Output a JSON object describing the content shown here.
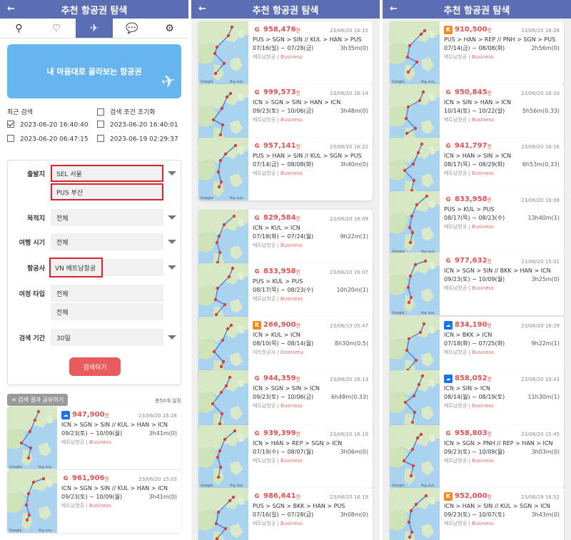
{
  "header": {
    "title": "추천 항공권 탐색",
    "back": "←"
  },
  "tabs": [
    {
      "icon": "search-icon",
      "glyph": "⚲"
    },
    {
      "icon": "heart-icon",
      "glyph": "♡"
    },
    {
      "icon": "ticket-icon",
      "glyph": "✈"
    },
    {
      "icon": "chat-icon",
      "glyph": "💬"
    },
    {
      "icon": "gear-icon",
      "glyph": "⚙"
    }
  ],
  "banner": {
    "text": "내 마음대로 골라보는 항공권"
  },
  "recent": {
    "label": "최근 검색",
    "reset": "검색 조건 초기화",
    "items": [
      "2023-06-20 16:40:40",
      "2023-06-20 16:40:01",
      "2023-06-20 06:47:15",
      "2023-06-19 02:29:37"
    ]
  },
  "form": {
    "departure_label": "출발지",
    "departure_1": "SEL 서울",
    "departure_2": "PUS 부산",
    "destination_label": "목적지",
    "destination": "전체",
    "period_label": "여행 시기",
    "period": "전체",
    "airline_label": "항공사",
    "airline": "VN 베트남항공",
    "tripType_label": "여정 타입",
    "tripType_1": "전체",
    "tripType_2": "전체",
    "range_label": "검색 기간",
    "range": "30일",
    "search_button": "검색하기"
  },
  "share": {
    "button": "검색 결과 공유하기",
    "total": "총50개 일정"
  },
  "won": "원",
  "p1cards": [
    {
      "logo": "s",
      "price": "947,900",
      "time": "23/06/20 16:28",
      "route": "ICN > SGN > SIN // KUL > HAN > ICN",
      "dates": "09/23(토) ~ 10/09(월)",
      "dur": "3h41m(0)",
      "airline": "베트남항공",
      "cls": "Business"
    },
    {
      "logo": "g",
      "price": "961,906",
      "time": "23/06/20 15:03",
      "route": "ICN > SGN > SIN // KUL > HAN > ICN",
      "dates": "09/23(토) ~ 10/09(월)",
      "dur": "3h41m(0)",
      "airline": "베트남항공",
      "cls": "Business"
    }
  ],
  "p2cards": [
    {
      "logo": "g",
      "price": "958,476",
      "time": "23/06/20 16:15",
      "route": "PUS > SGN > SIN // KUL > HAN > PUS",
      "dates": "07/16(일) ~ 07/28(금)",
      "dur": "3h35m(0)",
      "airline": "베트남항공",
      "cls": "Business"
    },
    {
      "logo": "g",
      "price": "999,573",
      "time": "23/06/20 16:14",
      "route": "ICN > SGN > SIN > HAN > ICN",
      "dates": "09/23(토) ~ 10/06(금)",
      "dur": "3h48m(0)",
      "airline": "베트남항공",
      "cls": "Business"
    },
    {
      "logo": "g",
      "price": "957,141",
      "time": "23/06/20 16:22",
      "route": "PUS > HAN > SIN // KUL > SGN > PUS",
      "dates": "07/14(금) ~ 08/08(화)",
      "dur": "3h40m(0)",
      "airline": "베트남항공",
      "cls": "Business"
    },
    {
      "logo": "g",
      "price": "829,584",
      "time": "23/06/20 16:09",
      "route": "ICN > KUL > ICN",
      "dates": "07/18(화) ~ 07/24(월)",
      "dur": "9h22m(1)",
      "airline": "베트남항공",
      "cls": "Business"
    },
    {
      "logo": "g",
      "price": "833,958",
      "time": "23/06/20 16:07",
      "route": "PUS > KUL > PUS",
      "dates": "08/17(목) ~ 08/23(수)",
      "dur": "10h20m(1)",
      "airline": "베트남항공",
      "cls": "Business"
    },
    {
      "logo": "k",
      "price": "266,900",
      "time": "23/06/15 05:47",
      "route": "ICN > KUL > ICN",
      "dates": "08/10(목) ~ 08/14(월)",
      "dur": "8h30m(0.5)",
      "airline": "여러항공사",
      "cls": "Economy"
    },
    {
      "logo": "g",
      "price": "944,359",
      "time": "23/06/20 16:13",
      "route": "ICN > SGN > SIN > ICN",
      "dates": "09/23(토) ~ 10/06(금)",
      "dur": "6h48m(0.33)",
      "airline": "베트남항공",
      "cls": "Business"
    },
    {
      "logo": "g",
      "price": "939,399",
      "time": "23/06/20 16:19",
      "route": "ICN > HAN > REP > SGN > ICN",
      "dates": "07/19(수) ~ 08/07(월)",
      "dur": "3h06m(0)",
      "airline": "베트남항공",
      "cls": "Business"
    },
    {
      "logo": "g",
      "price": "986,641",
      "time": "23/06/20 16:19",
      "route": "PUS > SGN > BKK > HAN > PUS",
      "dates": "07/16(일) ~ 07/28(금)",
      "dur": "3h08m(0)",
      "airline": "베트남항공",
      "cls": "Business"
    }
  ],
  "p3cards": [
    {
      "logo": "k",
      "price": "910,500",
      "time": "23/06/20 16:28",
      "route": "PUS > HAN > REP // PNH > SGN > PUS",
      "dates": "07/14(금) ~ 08/08(화)",
      "dur": "2h56m(0)",
      "airline": "베트남항공",
      "cls": "Business"
    },
    {
      "logo": "g",
      "price": "950,845",
      "time": "23/06/20 16:10",
      "route": "ICN > SIN > HAN > ICN",
      "dates": "10/14(토) ~ 10/22(일)",
      "dur": "5h56m(0.33)",
      "airline": "베트남항공",
      "cls": "Business"
    },
    {
      "logo": "g",
      "price": "941,797",
      "time": "23/06/20 16:16",
      "route": "ICN > HAN > SIN > ICN",
      "dates": "08/17(목) ~ 08/29(화)",
      "dur": "6h53m(0.33)",
      "airline": "베트남항공",
      "cls": "Business"
    },
    {
      "logo": "g",
      "price": "833,958",
      "time": "23/06/20 16:08",
      "route": "PUS > KUL > PUS",
      "dates": "08/17(목) ~ 08/23(수)",
      "dur": "13h40m(1)",
      "airline": "베트남항공",
      "cls": "Business"
    },
    {
      "logo": "g",
      "price": "977,632",
      "time": "23/06/20 15:01",
      "route": "ICN > SGN > SIN // BKK > HAN > ICN",
      "dates": "09/23(토) ~ 10/09(월)",
      "dur": "3h25m(0)",
      "airline": "베트남항공",
      "cls": "Business"
    },
    {
      "logo": "s",
      "price": "834,190",
      "time": "23/06/20 16:29",
      "route": "ICN > BKK > ICN",
      "dates": "07/18(화) ~ 07/25(화)",
      "dur": "9h22m(1)",
      "airline": "베트남항공",
      "cls": "Business"
    },
    {
      "logo": "s",
      "price": "858,052",
      "time": "23/06/20 10:43",
      "route": "ICN > SIN > ICN",
      "dates": "08/14(월) ~ 08/19(토)",
      "dur": "11h30m(1)",
      "airline": "베트남항공",
      "cls": "Business"
    },
    {
      "logo": "g",
      "price": "958,803",
      "time": "23/06/20 15:45",
      "route": "ICN > SGN > PNH // REP > HAN > ICN",
      "dates": "09/23(토) ~ 10/09(월)",
      "dur": "3h03m(0)",
      "airline": "베트남항공",
      "cls": "Business"
    },
    {
      "logo": "k",
      "price": "952,000",
      "time": "23/06/19 16:52",
      "route": "ICN > HAN > SIN // KUL > SGN > ICN",
      "dates": "09/23(토) ~ 10/07(토)",
      "dur": "3h43m(0)",
      "airline": "베트남항공",
      "cls": "Business"
    }
  ]
}
